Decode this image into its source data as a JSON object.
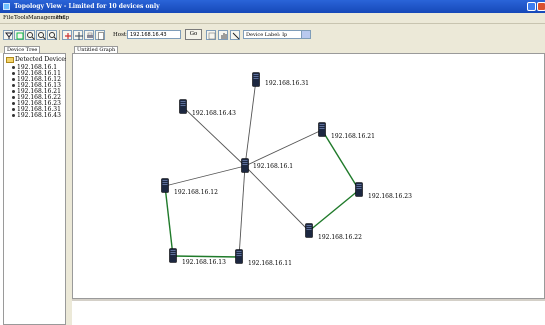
{
  "window": {
    "title": "Topology View - Limited for 10 devices only"
  },
  "menu": [
    "File",
    "Tools",
    "Management",
    "Help"
  ],
  "toolbar": {
    "host_label": "Host:",
    "host_value": "192.168.16.43",
    "go_label": "Go",
    "device_label_value": "Device Label: Ip"
  },
  "tabs": {
    "left": "Device Tree",
    "main": "Untitled Graph"
  },
  "tree": {
    "root": "Detected Devices",
    "items": [
      "192.168.16.1",
      "192.168.16.11",
      "192.168.16.12",
      "192.168.16.13",
      "192.168.16.21",
      "192.168.16.22",
      "192.168.16.23",
      "192.168.16.31",
      "192.168.16.43"
    ]
  },
  "graph": {
    "nodes": [
      {
        "id": "192.168.16.1"
      },
      {
        "id": "192.168.16.31"
      },
      {
        "id": "192.168.16.43"
      },
      {
        "id": "192.168.16.21"
      },
      {
        "id": "192.168.16.12"
      },
      {
        "id": "192.168.16.23"
      },
      {
        "id": "192.168.16.22"
      },
      {
        "id": "192.168.16.13"
      },
      {
        "id": "192.168.16.11"
      }
    ],
    "edges": [
      [
        "192.168.16.1",
        "192.168.16.31"
      ],
      [
        "192.168.16.1",
        "192.168.16.43"
      ],
      [
        "192.168.16.1",
        "192.168.16.21"
      ],
      [
        "192.168.16.1",
        "192.168.16.12"
      ],
      [
        "192.168.16.1",
        "192.168.16.22"
      ],
      [
        "192.168.16.1",
        "192.168.16.11"
      ],
      [
        "192.168.16.21",
        "192.168.16.23"
      ],
      [
        "192.168.16.23",
        "192.168.16.22"
      ],
      [
        "192.168.16.12",
        "192.168.16.13"
      ],
      [
        "192.168.16.13",
        "192.168.16.11"
      ]
    ]
  }
}
